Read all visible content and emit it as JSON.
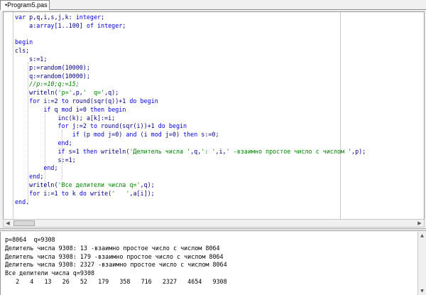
{
  "tab": {
    "label": "•Program5.pas"
  },
  "code_lines": [
    [
      [
        "kw",
        "var"
      ],
      [
        "tx",
        " p,q,i,s,j,k: "
      ],
      [
        "kw",
        "integer"
      ],
      [
        "tx",
        ";"
      ]
    ],
    [
      [
        "tx",
        "    a:"
      ],
      [
        "kw",
        "array"
      ],
      [
        "tx",
        "[1..100] "
      ],
      [
        "kw",
        "of integer"
      ],
      [
        "tx",
        ";"
      ]
    ],
    [],
    [
      [
        "kw",
        "begin"
      ]
    ],
    [
      [
        "tx",
        "cls;"
      ]
    ],
    [
      [
        "tx",
        "    s:=1;"
      ]
    ],
    [
      [
        "tx",
        "    p:=random(10000);"
      ]
    ],
    [
      [
        "tx",
        "    q:=random(10000);"
      ]
    ],
    [
      [
        "com",
        "    //p:=10;q:=15;"
      ]
    ],
    [
      [
        "tx",
        "    writeln("
      ],
      [
        "str",
        "'p='"
      ],
      [
        "tx",
        ",p,"
      ],
      [
        "str",
        "'  q='"
      ],
      [
        "tx",
        ",q);"
      ]
    ],
    [
      [
        "tx",
        "    "
      ],
      [
        "kw",
        "for"
      ],
      [
        "tx",
        " i:=2 "
      ],
      [
        "kw",
        "to"
      ],
      [
        "tx",
        " round(sqr(q))+1 "
      ],
      [
        "kw",
        "do begin"
      ]
    ],
    [
      [
        "tx",
        "        "
      ],
      [
        "kw",
        "if"
      ],
      [
        "tx",
        " q "
      ],
      [
        "kw",
        "mod"
      ],
      [
        "tx",
        " i=0 "
      ],
      [
        "kw",
        "then begin"
      ]
    ],
    [
      [
        "tx",
        "            inc(k); a[k]:=i;"
      ]
    ],
    [
      [
        "tx",
        "            "
      ],
      [
        "kw",
        "for"
      ],
      [
        "tx",
        " j:=2 "
      ],
      [
        "kw",
        "to"
      ],
      [
        "tx",
        " round(sqr(i))+1 "
      ],
      [
        "kw",
        "do begin"
      ]
    ],
    [
      [
        "tx",
        "                "
      ],
      [
        "kw",
        "if"
      ],
      [
        "tx",
        " (p "
      ],
      [
        "kw",
        "mod"
      ],
      [
        "tx",
        " j=0) "
      ],
      [
        "kw",
        "and"
      ],
      [
        "tx",
        " (i "
      ],
      [
        "kw",
        "mod"
      ],
      [
        "tx",
        " j=0) "
      ],
      [
        "kw",
        "then"
      ],
      [
        "tx",
        " s:=0;"
      ]
    ],
    [
      [
        "tx",
        "            "
      ],
      [
        "kw",
        "end"
      ],
      [
        "tx",
        ";"
      ]
    ],
    [
      [
        "tx",
        "            "
      ],
      [
        "kw",
        "if"
      ],
      [
        "tx",
        " s=1 "
      ],
      [
        "kw",
        "then"
      ],
      [
        "tx",
        " writeln("
      ],
      [
        "str",
        "'Делитель числа '"
      ],
      [
        "tx",
        ",q,"
      ],
      [
        "str",
        "': '"
      ],
      [
        "tx",
        ",i,"
      ],
      [
        "str",
        "' -взаимно простое число с числом '"
      ],
      [
        "tx",
        ",p);"
      ]
    ],
    [
      [
        "tx",
        "            s:=1;"
      ]
    ],
    [
      [
        "tx",
        "        "
      ],
      [
        "kw",
        "end"
      ],
      [
        "tx",
        ";"
      ]
    ],
    [
      [
        "tx",
        "    "
      ],
      [
        "kw",
        "end"
      ],
      [
        "tx",
        ";"
      ]
    ],
    [
      [
        "tx",
        "    writeln("
      ],
      [
        "str",
        "'Все делители числа q='"
      ],
      [
        "tx",
        ",q);"
      ]
    ],
    [
      [
        "tx",
        "    "
      ],
      [
        "kw",
        "for"
      ],
      [
        "tx",
        " i:=1 "
      ],
      [
        "kw",
        "to"
      ],
      [
        "tx",
        " k "
      ],
      [
        "kw",
        "do"
      ],
      [
        "tx",
        " write("
      ],
      [
        "str",
        "'   '"
      ],
      [
        "tx",
        ",a[i]);"
      ]
    ],
    [
      [
        "kw",
        "end"
      ],
      [
        "tx",
        "."
      ]
    ]
  ],
  "output_lines": [
    "p=8064  q=9308",
    "Делитель числа 9308: 13 -взаимно простое число с числом 8064",
    "Делитель числа 9308: 179 -взаимно простое число с числом 8064",
    "Делитель числа 9308: 2327 -взаимно простое число с числом 8064",
    "Все делители числа q=9308",
    "   2   4   13   26   52   179   358   716   2327   4654   9308"
  ],
  "scrollbar": {
    "left_arrow": "◀",
    "right_arrow": "▶",
    "up_arrow": "▲",
    "down_arrow": "▼"
  },
  "colors": {
    "keyword": "#0000e0",
    "string": "#008000",
    "comment": "#008000",
    "text": "#000080"
  }
}
